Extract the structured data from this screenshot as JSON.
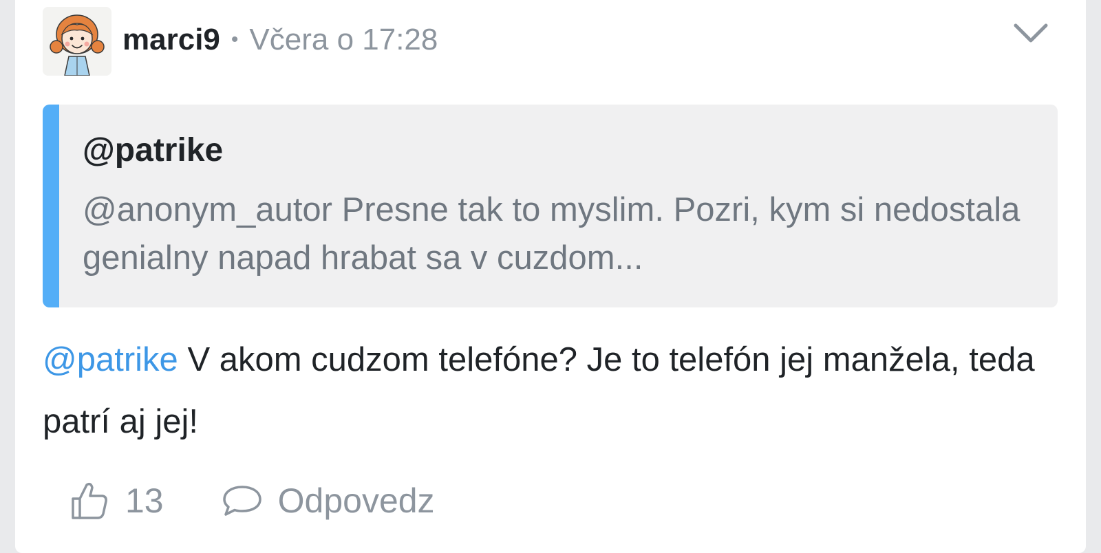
{
  "post": {
    "author": {
      "username": "marci9",
      "avatar_icon": "cartoon-girl-avatar"
    },
    "separator": "•",
    "timestamp": "Včera o 17:28",
    "menu_icon": "chevron-down-icon",
    "quote": {
      "author": "@patrike",
      "text": "@anonym_autor Presne tak to myslim. Pozri, kym si nedostala genialny napad hrabat sa v cuzdom..."
    },
    "message": {
      "mention": "@patrike",
      "text": " V akom cudzom telefóne? Je to telefón jej manžela, teda patrí aj jej!"
    },
    "actions": {
      "like_icon": "thumbs-up-icon",
      "like_count": "13",
      "reply_icon": "speech-bubble-icon",
      "reply_label": "Odpovedz"
    }
  },
  "colors": {
    "accent": "#54aef7",
    "mention": "#3d97e6",
    "muted": "#8d959e",
    "text": "#1f2327",
    "quote_bg": "#f0f0f1"
  }
}
